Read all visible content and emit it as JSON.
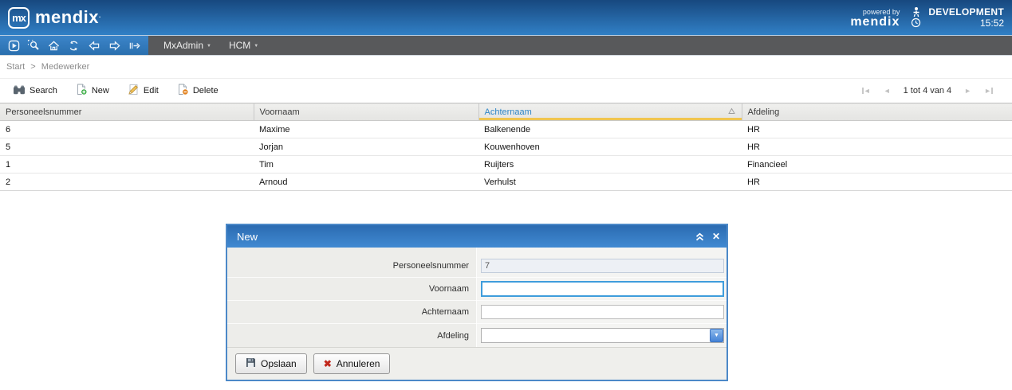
{
  "header": {
    "logo_monogram": "mx",
    "brand": "mendix",
    "powered_by_label": "powered by",
    "powered_by_brand": "mendix",
    "environment_label": "DEVELOPMENT",
    "clock_time": "15:52"
  },
  "navbar": {
    "icons": [
      "run-icon",
      "zoom-icon",
      "home-icon",
      "refresh-icon",
      "back-icon",
      "forward-icon",
      "logout-icon"
    ],
    "menus": [
      {
        "label": "MxAdmin"
      },
      {
        "label": "HCM"
      }
    ]
  },
  "breadcrumb": {
    "items": [
      "Start",
      "Medewerker"
    ],
    "separator": ">"
  },
  "actionbar": {
    "search_label": "Search",
    "new_label": "New",
    "edit_label": "Edit",
    "delete_label": "Delete",
    "pagination": {
      "status": "1 tot 4 van 4"
    }
  },
  "table": {
    "columns": [
      "Personeelsnummer",
      "Voornaam",
      "Achternaam",
      "Afdeling"
    ],
    "sorted_column": "Achternaam",
    "sort_direction": "ascending",
    "rows": [
      [
        "6",
        "Maxime",
        "Balkenende",
        "HR"
      ],
      [
        "5",
        "Jorjan",
        "Kouwenhoven",
        "HR"
      ],
      [
        "1",
        "Tim",
        "Ruijters",
        "Financieel"
      ],
      [
        "2",
        "Arnoud",
        "Verhulst",
        "HR"
      ]
    ]
  },
  "dialog": {
    "title": "New",
    "fields": [
      {
        "label": "Personeelsnummer",
        "value": "7",
        "state": "readonly"
      },
      {
        "label": "Voornaam",
        "value": "",
        "state": "focused"
      },
      {
        "label": "Achternaam",
        "value": "",
        "state": "normal"
      },
      {
        "label": "Afdeling",
        "value": "",
        "state": "dropdown"
      }
    ],
    "save_label": "Opslaan",
    "cancel_label": "Annuleren"
  },
  "colors": {
    "header_blue_top": "#17487f",
    "header_blue_bottom": "#3180c6",
    "navbar_gray": "#58595b",
    "navbar_icon_blue": "#2e77bd",
    "sorted_header_text": "#2e86c8",
    "sort_underline": "#f0c550",
    "focus_border": "#3f9ddc",
    "dialog_border": "#4c89c8",
    "cancel_red": "#c1271b",
    "new_plus_green": "#3fae49",
    "delete_circle_orange": "#e2821f"
  }
}
